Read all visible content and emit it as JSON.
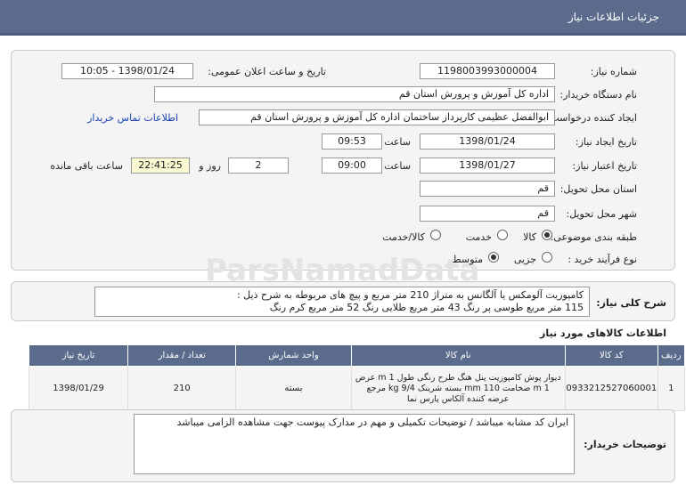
{
  "header": {
    "title": "جزئیات اطلاعات نیاز"
  },
  "form": {
    "need_number_label": "شماره نیاز:",
    "need_number": "1198003993000004",
    "announce_label": "تاریخ و ساعت اعلان عمومی:",
    "announce_value": "1398/01/24 - 10:05",
    "buyer_org_label": "نام دستگاه خریدار:",
    "buyer_org": "اداره کل آموزش و پرورش استان قم",
    "creator_label": "ایجاد کننده درخواست:",
    "creator": "ابوالفضل عظیمی کارپرداز ساختمان اداره کل آموزش و پرورش استان قم",
    "contact_link": "اطلاعات تماس خریدار",
    "created_date_label": "تاریخ ایجاد نیاز:",
    "created_date": "1398/01/24",
    "time_label": "ساعت",
    "created_time": "09:53",
    "validity_label": "تاریخ اعتبار نیاز:",
    "validity_date": "1398/01/27",
    "validity_time": "09:00",
    "days_value": "2",
    "days_label": "روز و",
    "remaining_time": "22:41:25",
    "remaining_label": "ساعت باقی مانده",
    "province_label": "استان محل تحویل:",
    "province": "قم",
    "city_label": "شهر محل تحویل:",
    "city": "قم",
    "category_label": "طبقه بندی موضوعی:",
    "category_options": [
      "کالا",
      "خدمت",
      "کالا/خدمت"
    ],
    "process_label": "نوع فرآیند خرید :",
    "process_options": [
      "جزیی",
      "متوسط"
    ]
  },
  "description": {
    "label": "شرح کلی نیاز:",
    "line1": "کامپوزیت آلومکس یا آلگانس به متراژ 210 متر مربع و پیچ های مربوطه  به شرح ذیل :",
    "line2": "115 متر مربع  طوسی پر رنگ  43 متر مربع طلایی رنگ  52 متر مربع کرم رنگ"
  },
  "items_title": "اطلاعات کالاهای مورد نیاز",
  "table": {
    "headers": [
      "ردیف",
      "کد کالا",
      "نام کالا",
      "واحد شمارش",
      "تعداد / مقدار",
      "تاریخ نیاز"
    ],
    "rows": [
      {
        "row": "1",
        "code": "0933212527060001",
        "name": "دیوار پوش کامپوزیت پنل هنگ طرح رنگی طول 1 m عرض 1 m ضخامت 110 mm بسته شرینک 9/4 kg مرجع عرضه کننده آلکاس پارس نما",
        "unit": "بسته",
        "qty": "210",
        "date": "1398/01/29"
      }
    ]
  },
  "notes": {
    "label": "توضیحات خریدار:",
    "text": "ایران کد مشابه میباشد / توضیحات تکمیلی و مهم در مدارک پیوست جهت مشاهده الزامی میباشد"
  },
  "watermark": {
    "line1": "ParsNamadData"
  }
}
